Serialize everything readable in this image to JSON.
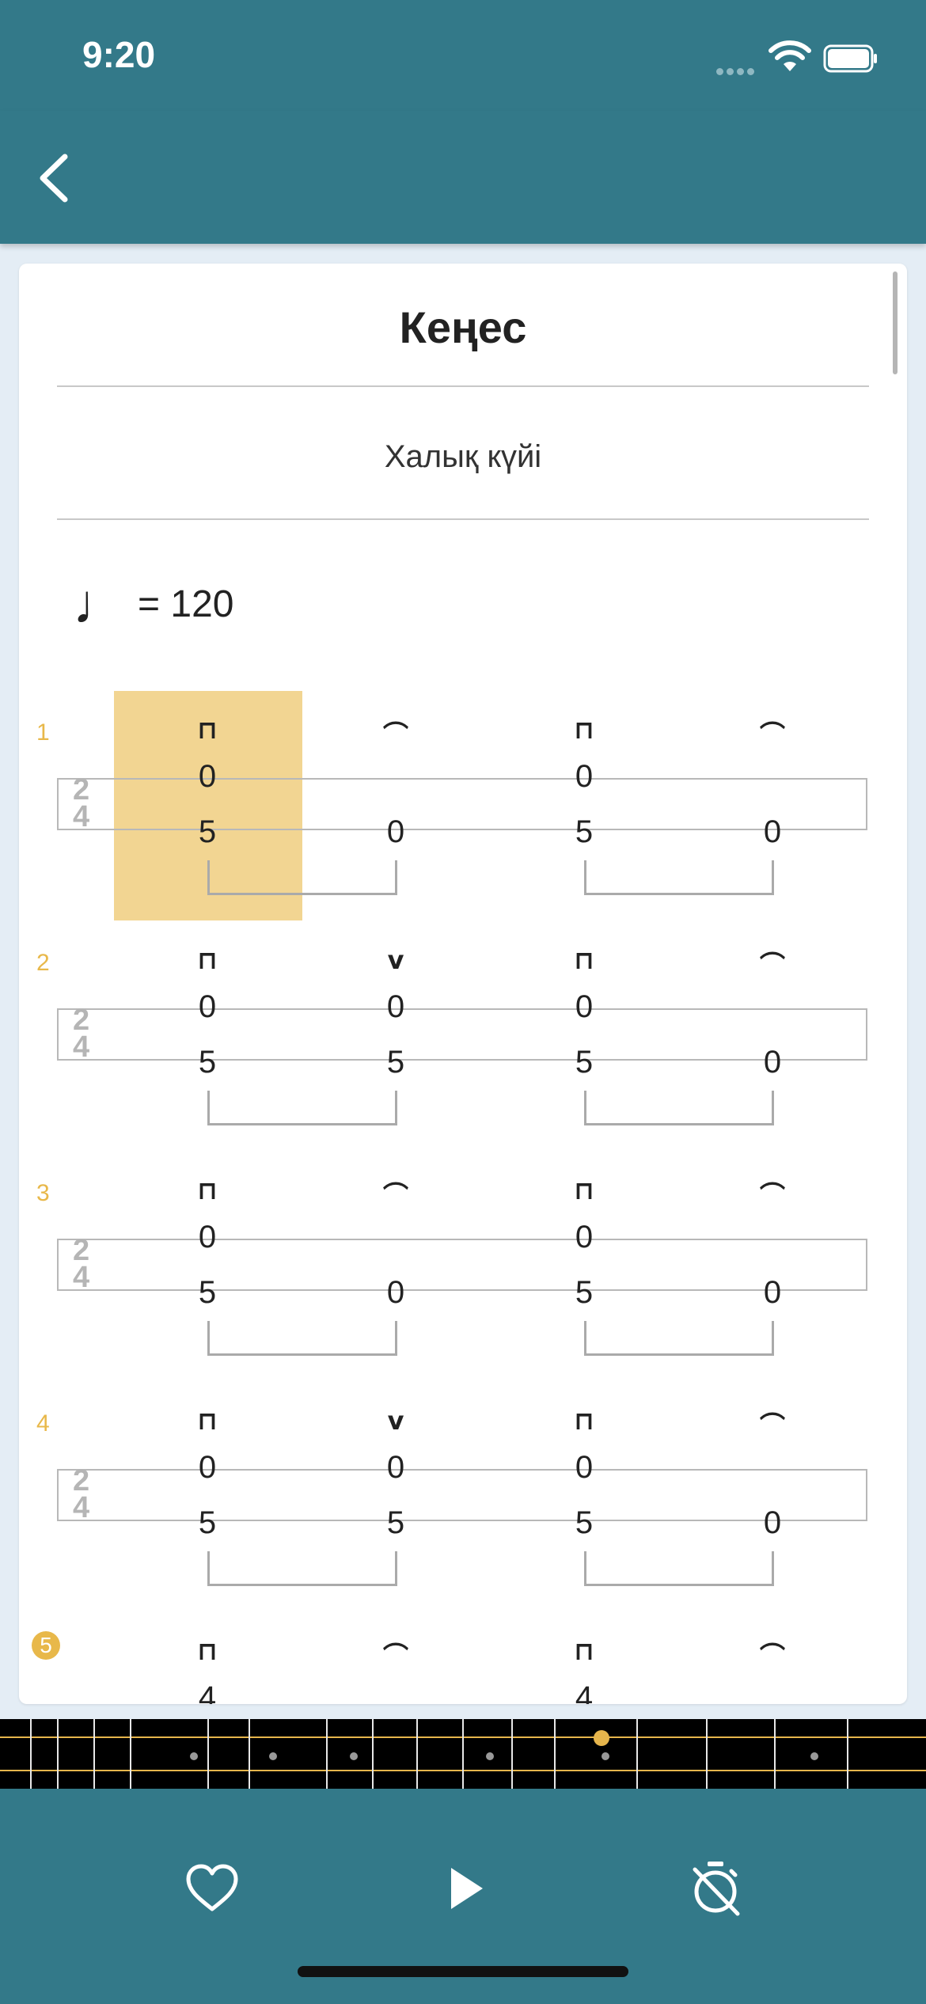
{
  "status_bar": {
    "time": "9:20"
  },
  "header": {
    "back_icon": "chevron-left-icon"
  },
  "piece": {
    "title": "Кеңес",
    "subtitle": "Халық күйі"
  },
  "tempo": {
    "note_glyph": "♩",
    "text": "= 120"
  },
  "time_signature": {
    "top": "2",
    "bottom": "4"
  },
  "measures": [
    {
      "number": "1",
      "top_symbols": [
        "⊓",
        "⌒",
        "⊓",
        "⌒"
      ],
      "upper_values": [
        "0",
        "",
        "0",
        ""
      ],
      "lower_values": [
        "5",
        "0",
        "5",
        "0"
      ],
      "highlighted": true
    },
    {
      "number": "2",
      "top_symbols": [
        "⊓",
        "v",
        "⊓",
        "⌒"
      ],
      "upper_values": [
        "0",
        "0",
        "0",
        ""
      ],
      "lower_values": [
        "5",
        "5",
        "5",
        "0"
      ]
    },
    {
      "number": "3",
      "top_symbols": [
        "⊓",
        "⌒",
        "⊓",
        "⌒"
      ],
      "upper_values": [
        "0",
        "",
        "0",
        ""
      ],
      "lower_values": [
        "5",
        "0",
        "5",
        "0"
      ]
    },
    {
      "number": "4",
      "top_symbols": [
        "⊓",
        "v",
        "⊓",
        "⌒"
      ],
      "upper_values": [
        "0",
        "0",
        "0",
        ""
      ],
      "lower_values": [
        "5",
        "5",
        "5",
        "0"
      ]
    },
    {
      "number": "5",
      "top_symbols": [
        "⊓",
        "⌒",
        "⊓",
        "⌒"
      ],
      "upper_values": [
        "4",
        "",
        "4",
        ""
      ],
      "lower_values": [
        "",
        "",
        "",
        ""
      ]
    }
  ],
  "bottom_bar": {
    "buttons": [
      "heart-icon",
      "play-icon",
      "timer-off-icon"
    ]
  },
  "colors": {
    "primary": "#337989",
    "accent": "#e8b84a",
    "highlight": "#f2d592"
  }
}
